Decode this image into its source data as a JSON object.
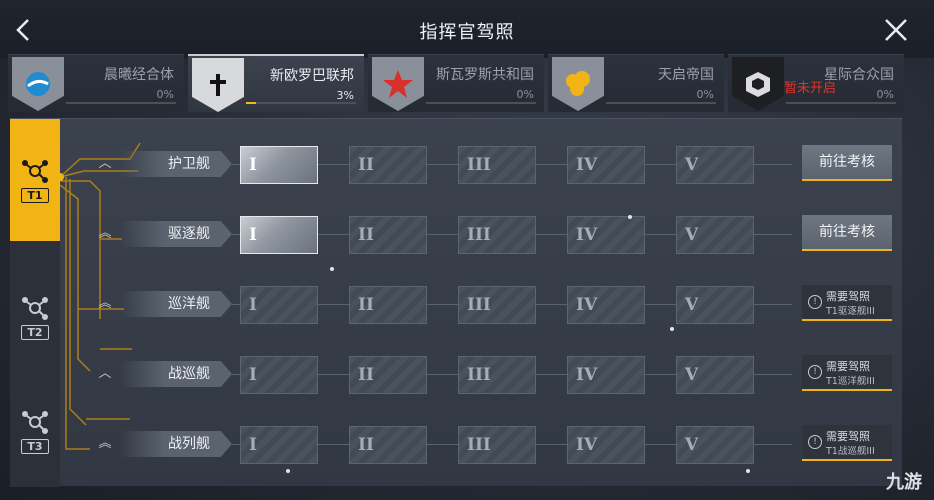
{
  "header": {
    "title": "指挥官驾照",
    "back_icon": "chevron-left-icon",
    "close_icon": "close-icon"
  },
  "factions": [
    {
      "name": "晨曦经合体",
      "progress": "0%",
      "fill": 0,
      "color": "#1f8bd1",
      "icon": "circle-swirl-icon"
    },
    {
      "name": "新欧罗巴联邦",
      "progress": "3%",
      "fill": 0.03,
      "color": "#ffffff",
      "icon": "cross-icon",
      "active": true
    },
    {
      "name": "斯瓦罗斯共和国",
      "progress": "0%",
      "fill": 0,
      "color": "#d8302a",
      "icon": "star-icon"
    },
    {
      "name": "天启帝国",
      "progress": "0%",
      "fill": 0,
      "color": "#f2b315",
      "icon": "cloud-icon"
    },
    {
      "name": "星际合众国",
      "progress": "0%",
      "fill": 0,
      "color": "#2a2a2a",
      "icon": "cube-icon",
      "locked_text": "暂未开启"
    }
  ],
  "tiers": [
    {
      "label": "T1",
      "active": true
    },
    {
      "label": "T2",
      "active": false
    },
    {
      "label": "T3",
      "active": false
    }
  ],
  "levels": [
    "I",
    "II",
    "III",
    "IV",
    "V"
  ],
  "ships": [
    {
      "name": "护卫舰",
      "chevron": "︿",
      "unlocked": 1,
      "action": "前往考核"
    },
    {
      "name": "驱逐舰",
      "chevron": "︽",
      "unlocked": 1,
      "action": "前往考核"
    },
    {
      "name": "巡洋舰",
      "chevron": "︽",
      "unlocked": 0,
      "req_title": "需要驾照",
      "req_detail": "T1驱逐舰III"
    },
    {
      "name": "战巡舰",
      "chevron": "︿",
      "unlocked": 0,
      "req_title": "需要驾照",
      "req_detail": "T1巡洋舰III"
    },
    {
      "name": "战列舰",
      "chevron": "︽",
      "unlocked": 0,
      "req_title": "需要驾照",
      "req_detail": "T1战巡舰III"
    }
  ],
  "watermark": "九游",
  "accent_color": "#f2b315"
}
